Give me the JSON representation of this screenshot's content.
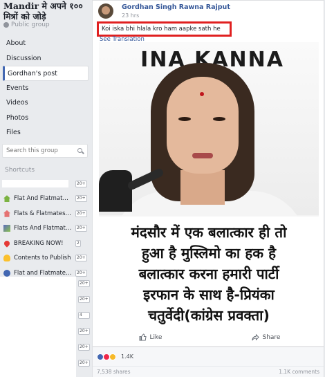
{
  "group": {
    "title": "Mandir मे अपने १०० मित्रों को जोड़े",
    "privacy": "Public group"
  },
  "nav": [
    "About",
    "Discussion",
    "Gordhan's post",
    "Events",
    "Videos",
    "Photos",
    "Files"
  ],
  "search": {
    "placeholder": "Search this group"
  },
  "shortcuts": {
    "heading": "Shortcuts",
    "items": [
      {
        "label": "",
        "badge": "20+",
        "icon_color": "#e9ebee"
      },
      {
        "label": "Flat And Flatmates ...",
        "badge": "20+",
        "icon_color": "#7cb342"
      },
      {
        "label": "Flats & Flatmates ( ...",
        "badge": "20+",
        "icon_color": "#e57373"
      },
      {
        "label": "Flats And Flatmate...",
        "badge": "20+",
        "icon_color": "#5c6bc0"
      },
      {
        "label": "BREAKING NOW!",
        "badge": "2",
        "icon_color": "#e53935"
      },
      {
        "label": "Contents to Publish",
        "badge": "20+",
        "icon_color": "#fbc02d"
      },
      {
        "label": "Flat and Flatmates ...",
        "badge": "20+",
        "icon_color": "#4267b2"
      }
    ],
    "extra_badges": [
      "20+",
      "20+",
      "4",
      "20+",
      "20+",
      "20+"
    ]
  },
  "post": {
    "author": "Gordhan Singh Rawna Rajput",
    "time": "23 hrs",
    "text": "Koi iska bhi hlala kro ham aapke sath he",
    "see_translation": "See Translation",
    "image_banner": "INA KANNA",
    "caption_lines": [
      "मंदसौर में एक बलात्कार ही तो",
      "हुआ है मुस्लिमो का हक है",
      "बलात्कार करना हमारी पार्टी",
      "इरफान के साथ है-प्रियंका",
      "चतुर्वेदी(कांग्रेस प्रवक्ता)"
    ],
    "like_label": "Like",
    "share_label": "Share",
    "reaction_count": "1.4K",
    "shares": "7,538 shares",
    "comments": "1.1K comments"
  },
  "colors": {
    "link": "#365899",
    "highlight_border": "#e02020",
    "like_blue": "#4267b2",
    "love_red": "#f0284a",
    "haha_yellow": "#f7b928"
  }
}
